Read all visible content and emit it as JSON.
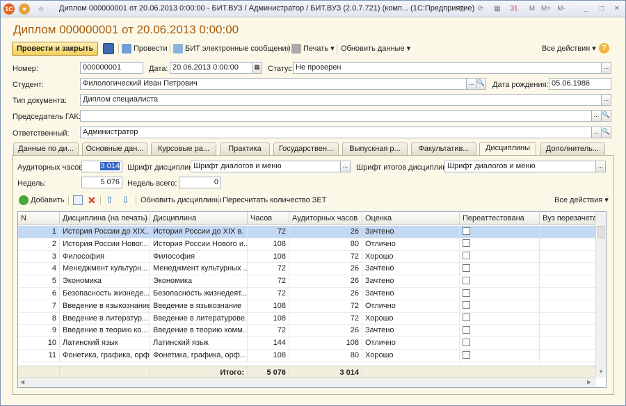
{
  "window": {
    "title": "Диплом 000000001 от 20.06.2013 0:00:00 - БИТ.ВУЗ / Администратор / БИТ.ВУЗ (2.0.7.721) (комп... (1С:Предприятие)"
  },
  "titlebar_buttons": [
    "M",
    "M+",
    "M-"
  ],
  "doc_title": "Диплом 000000001 от 20.06.2013 0:00:00",
  "toolbar": {
    "post_close": "Провести и закрыть",
    "post": "Провести",
    "messages": "БИТ электронные сообщения",
    "print": "Печать",
    "refresh": "Обновить данные",
    "all_actions": "Все действия"
  },
  "form": {
    "number_label": "Номер:",
    "number": "000000001",
    "date_label": "Дата:",
    "date": "20.06.2013  0:00:00",
    "status_label": "Статус:",
    "status": "Не проверен",
    "student_label": "Студент:",
    "student": "Филологический Иван Петрович",
    "birth_label": "Дата рождения:",
    "birth": "05.06.1986",
    "doctype_label": "Тип документа:",
    "doctype": "Диплом специалиста",
    "gak_label": "Председатель ГАК:",
    "gak": "",
    "resp_label": "Ответственный:",
    "resp": "Администратор"
  },
  "tabs": [
    "Данные по ди...",
    "Основные дан...",
    "Курсовые ра...",
    "Практика",
    "Государствен...",
    "Выпускная р...",
    "Факультатив...",
    "Дисциплины",
    "Дополнитель..."
  ],
  "panel": {
    "aud_hours_label": "Аудиторных часов:",
    "aud_hours": "3 014",
    "font_disc_label": "Шрифт дисциплин:",
    "font_disc": "Шрифт диалогов и меню",
    "font_totals_label": "Шрифт итогов дисциплин:",
    "font_totals": "Шрифт диалогов и меню",
    "weeks_label": "Недель:",
    "weeks": "5 076",
    "weeks_total_label": "Недель всего:",
    "weeks_total": "0"
  },
  "grid_toolbar": {
    "add": "Добавить",
    "refresh_disc": "Обновить дисциплины",
    "recalc": "Пересчитать количество ЗЕТ",
    "all_actions": "Все действия"
  },
  "grid": {
    "columns": [
      "N",
      "Дисциплина (на печать)",
      "Дисциплина",
      "Часов",
      "Аудиторных часов",
      "Оценка",
      "Переаттестована",
      "Вуз перезачета"
    ],
    "rows": [
      [
        "1",
        "История России до XIX...",
        "История России до XIX в.",
        "72",
        "26",
        "Зачтено"
      ],
      [
        "2",
        "История России Новог...",
        "История России Нового и...",
        "108",
        "80",
        "Отлично"
      ],
      [
        "3",
        "Философия",
        "Философия",
        "108",
        "72",
        "Хорошо"
      ],
      [
        "4",
        "Менеджмент культурн...",
        "Менеджмент культурных ...",
        "72",
        "26",
        "Зачтено"
      ],
      [
        "5",
        "Экономика",
        "Экономика",
        "72",
        "26",
        "Зачтено"
      ],
      [
        "6",
        "Безопасность жизнеде...",
        "Безопасность жизнедеят...",
        "72",
        "26",
        "Зачтено"
      ],
      [
        "7",
        "Введение в языкознание",
        "Введение в языкознание",
        "108",
        "72",
        "Отлично"
      ],
      [
        "8",
        "Введение в литератур...",
        "Введение в литературове...",
        "108",
        "72",
        "Хорошо"
      ],
      [
        "9",
        "Введение в теорию ко...",
        "Введение в теорию комм...",
        "72",
        "26",
        "Зачтено"
      ],
      [
        "10",
        "Латинский язык",
        "Латинский язык",
        "144",
        "108",
        "Отлично"
      ],
      [
        "11",
        "Фонетика, графика, орф...",
        "Фонетика, графика, орф...",
        "108",
        "80",
        "Хорошо"
      ]
    ],
    "totals_label": "Итого:",
    "total_hours": "5 076",
    "total_aud": "3 014"
  },
  "colors": {
    "accent": "#a65b0b",
    "selected_row": "#c3d8f2"
  }
}
